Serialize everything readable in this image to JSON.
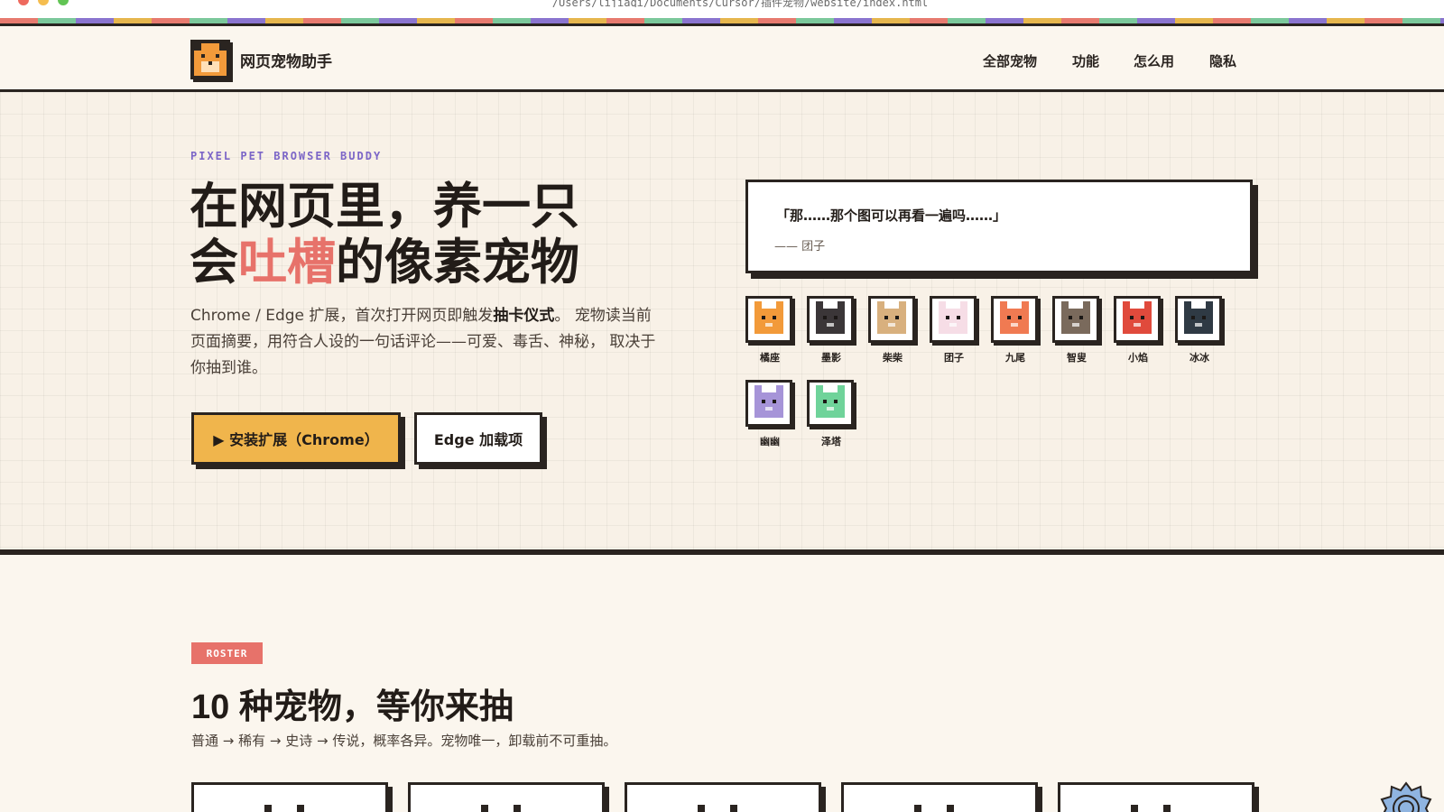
{
  "browser": {
    "url": "/Users/lijiaqi/Documents/Cursor/插件宠物/website/index.html"
  },
  "header": {
    "brand": "网页宠物助手",
    "nav": [
      "全部宠物",
      "功能",
      "怎么用",
      "隐私"
    ]
  },
  "hero": {
    "eyebrow": "PIXEL PET BROWSER BUDDY",
    "headline_line1": "在网页里，养一只",
    "headline_pre": "会",
    "headline_accent": "吐槽",
    "headline_post": "的像素宠物",
    "desc_part1": "Chrome / Edge 扩展，首次打开网页即触发",
    "desc_bold": "抽卡仪式",
    "desc_part2": "。 宠物读当前页面摘要，用符合人设的一句话评论——可爱、毒舌、神秘， 取决于你抽到谁。",
    "btn_primary": "▶ 安装扩展（Chrome）",
    "btn_secondary": "Edge 加载项",
    "quote": "「那……那个图可以再看一遍吗……」",
    "quote_author": "—— 团子",
    "pets": [
      {
        "name": "橘座",
        "color": "#f29a3a"
      },
      {
        "name": "墨影",
        "color": "#3b3638"
      },
      {
        "name": "柴柴",
        "color": "#d8b07e"
      },
      {
        "name": "团子",
        "color": "#f6dde6"
      },
      {
        "name": "九尾",
        "color": "#f07a52"
      },
      {
        "name": "智叟",
        "color": "#7a6a5c"
      },
      {
        "name": "小焰",
        "color": "#e04a3c"
      },
      {
        "name": "冰冰",
        "color": "#2f3a44"
      },
      {
        "name": "幽幽",
        "color": "#a694d8"
      },
      {
        "name": "泽塔",
        "color": "#6fd39a"
      }
    ]
  },
  "roster": {
    "tag": "ROSTER",
    "title": "10 种宠物，等你来抽",
    "subtitle": "普通 → 稀有 → 史诗 → 传说，概率各异。宠物唯一，卸载前不可重抽。"
  },
  "colors": {
    "ink": "#2a2420",
    "accent": "#e7726a",
    "gold": "#f0b54c",
    "purple": "#7b65c7"
  }
}
